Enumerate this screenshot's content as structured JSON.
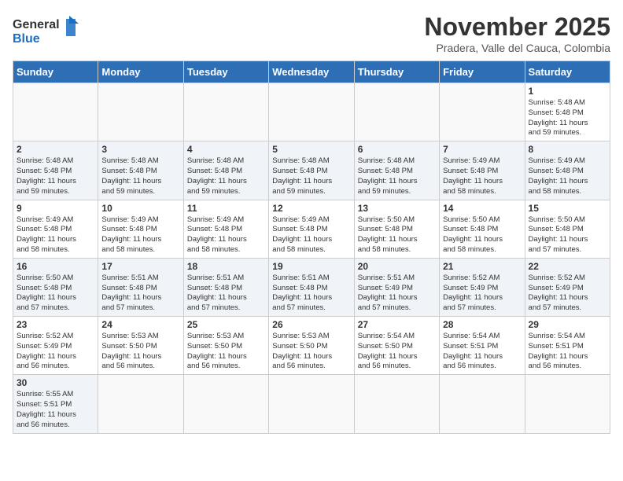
{
  "header": {
    "logo_general": "General",
    "logo_blue": "Blue",
    "month": "November 2025",
    "location": "Pradera, Valle del Cauca, Colombia"
  },
  "weekdays": [
    "Sunday",
    "Monday",
    "Tuesday",
    "Wednesday",
    "Thursday",
    "Friday",
    "Saturday"
  ],
  "weeks": [
    [
      {
        "day": "",
        "info": ""
      },
      {
        "day": "",
        "info": ""
      },
      {
        "day": "",
        "info": ""
      },
      {
        "day": "",
        "info": ""
      },
      {
        "day": "",
        "info": ""
      },
      {
        "day": "",
        "info": ""
      },
      {
        "day": "1",
        "info": "Sunrise: 5:48 AM\nSunset: 5:48 PM\nDaylight: 11 hours\nand 59 minutes."
      }
    ],
    [
      {
        "day": "2",
        "info": "Sunrise: 5:48 AM\nSunset: 5:48 PM\nDaylight: 11 hours\nand 59 minutes."
      },
      {
        "day": "3",
        "info": "Sunrise: 5:48 AM\nSunset: 5:48 PM\nDaylight: 11 hours\nand 59 minutes."
      },
      {
        "day": "4",
        "info": "Sunrise: 5:48 AM\nSunset: 5:48 PM\nDaylight: 11 hours\nand 59 minutes."
      },
      {
        "day": "5",
        "info": "Sunrise: 5:48 AM\nSunset: 5:48 PM\nDaylight: 11 hours\nand 59 minutes."
      },
      {
        "day": "6",
        "info": "Sunrise: 5:48 AM\nSunset: 5:48 PM\nDaylight: 11 hours\nand 59 minutes."
      },
      {
        "day": "7",
        "info": "Sunrise: 5:49 AM\nSunset: 5:48 PM\nDaylight: 11 hours\nand 58 minutes."
      },
      {
        "day": "8",
        "info": "Sunrise: 5:49 AM\nSunset: 5:48 PM\nDaylight: 11 hours\nand 58 minutes."
      }
    ],
    [
      {
        "day": "9",
        "info": "Sunrise: 5:49 AM\nSunset: 5:48 PM\nDaylight: 11 hours\nand 58 minutes."
      },
      {
        "day": "10",
        "info": "Sunrise: 5:49 AM\nSunset: 5:48 PM\nDaylight: 11 hours\nand 58 minutes."
      },
      {
        "day": "11",
        "info": "Sunrise: 5:49 AM\nSunset: 5:48 PM\nDaylight: 11 hours\nand 58 minutes."
      },
      {
        "day": "12",
        "info": "Sunrise: 5:49 AM\nSunset: 5:48 PM\nDaylight: 11 hours\nand 58 minutes."
      },
      {
        "day": "13",
        "info": "Sunrise: 5:50 AM\nSunset: 5:48 PM\nDaylight: 11 hours\nand 58 minutes."
      },
      {
        "day": "14",
        "info": "Sunrise: 5:50 AM\nSunset: 5:48 PM\nDaylight: 11 hours\nand 58 minutes."
      },
      {
        "day": "15",
        "info": "Sunrise: 5:50 AM\nSunset: 5:48 PM\nDaylight: 11 hours\nand 57 minutes."
      }
    ],
    [
      {
        "day": "16",
        "info": "Sunrise: 5:50 AM\nSunset: 5:48 PM\nDaylight: 11 hours\nand 57 minutes."
      },
      {
        "day": "17",
        "info": "Sunrise: 5:51 AM\nSunset: 5:48 PM\nDaylight: 11 hours\nand 57 minutes."
      },
      {
        "day": "18",
        "info": "Sunrise: 5:51 AM\nSunset: 5:48 PM\nDaylight: 11 hours\nand 57 minutes."
      },
      {
        "day": "19",
        "info": "Sunrise: 5:51 AM\nSunset: 5:48 PM\nDaylight: 11 hours\nand 57 minutes."
      },
      {
        "day": "20",
        "info": "Sunrise: 5:51 AM\nSunset: 5:49 PM\nDaylight: 11 hours\nand 57 minutes."
      },
      {
        "day": "21",
        "info": "Sunrise: 5:52 AM\nSunset: 5:49 PM\nDaylight: 11 hours\nand 57 minutes."
      },
      {
        "day": "22",
        "info": "Sunrise: 5:52 AM\nSunset: 5:49 PM\nDaylight: 11 hours\nand 57 minutes."
      }
    ],
    [
      {
        "day": "23",
        "info": "Sunrise: 5:52 AM\nSunset: 5:49 PM\nDaylight: 11 hours\nand 56 minutes."
      },
      {
        "day": "24",
        "info": "Sunrise: 5:53 AM\nSunset: 5:50 PM\nDaylight: 11 hours\nand 56 minutes."
      },
      {
        "day": "25",
        "info": "Sunrise: 5:53 AM\nSunset: 5:50 PM\nDaylight: 11 hours\nand 56 minutes."
      },
      {
        "day": "26",
        "info": "Sunrise: 5:53 AM\nSunset: 5:50 PM\nDaylight: 11 hours\nand 56 minutes."
      },
      {
        "day": "27",
        "info": "Sunrise: 5:54 AM\nSunset: 5:50 PM\nDaylight: 11 hours\nand 56 minutes."
      },
      {
        "day": "28",
        "info": "Sunrise: 5:54 AM\nSunset: 5:51 PM\nDaylight: 11 hours\nand 56 minutes."
      },
      {
        "day": "29",
        "info": "Sunrise: 5:54 AM\nSunset: 5:51 PM\nDaylight: 11 hours\nand 56 minutes."
      }
    ],
    [
      {
        "day": "30",
        "info": "Sunrise: 5:55 AM\nSunset: 5:51 PM\nDaylight: 11 hours\nand 56 minutes."
      },
      {
        "day": "",
        "info": ""
      },
      {
        "day": "",
        "info": ""
      },
      {
        "day": "",
        "info": ""
      },
      {
        "day": "",
        "info": ""
      },
      {
        "day": "",
        "info": ""
      },
      {
        "day": "",
        "info": ""
      }
    ]
  ]
}
